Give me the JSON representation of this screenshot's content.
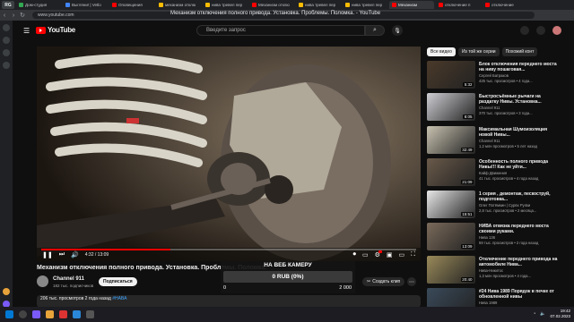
{
  "browser": {
    "tabs": [
      {
        "label": "Дом-студия",
        "color": "#34a853"
      },
      {
        "label": "Выгляни! | Vetlo",
        "color": "#4285f4"
      },
      {
        "label": "Оповещения",
        "color": "#ff0000"
      },
      {
        "label": "механизм отклю",
        "color": "#fbbc04"
      },
      {
        "label": "нива тревел пер",
        "color": "#fbbc04"
      },
      {
        "label": "Механизм отклю",
        "color": "#ff0000"
      },
      {
        "label": "нива тревел пер",
        "color": "#fbbc04"
      },
      {
        "label": "нива тревел пер",
        "color": "#fbbc04"
      },
      {
        "label": "Механизм",
        "color": "#ff0000",
        "active": true
      },
      {
        "label": "отключение п",
        "color": "#ff0000"
      },
      {
        "label": "отключение",
        "color": "#ff0000"
      }
    ],
    "logo": "RG",
    "url": "www.youtube.com",
    "page_title": "Механизм отключения полного привода. Установка. Проблемы. Поломка. - YouTube"
  },
  "youtube": {
    "brand": "YouTube",
    "search_placeholder": "Введите запрос"
  },
  "player": {
    "time": "4:32 / 13:09",
    "progress_fraction": 0.345
  },
  "video": {
    "title": "Механизм отключения полного привода. Установка. Проблемы. Поломка.",
    "channel": "Channel 911",
    "subscribers": "182 тыс. подписчиков",
    "subscribe_label": "Подписаться",
    "clip_label": "Создать клип",
    "stats": "206 тыс. просмотров 2 года назад",
    "stats_tag": "#НАВА"
  },
  "donation": {
    "title": "НА ВЕБ КАМЕРУ",
    "amount": "0 RUB (0%)",
    "min": "0",
    "max": "2 000"
  },
  "sidebar": {
    "chips": [
      "Все видео",
      "Из той же серии",
      "Похожий конт"
    ],
    "recommendations": [
      {
        "title": "Блок отключения переднего моста на ниву пошаговая...",
        "channel": "Сергей Батраков",
        "meta": "425 тыс. просмотров • 4 года...",
        "duration": "5:32",
        "color": "#4a3a2a"
      },
      {
        "title": "Быстросъёмные рычаги на раздатку Нивы. Установка...",
        "channel": "Channel 911",
        "meta": "370 тыс. просмотров • 3 года...",
        "duration": "8:05",
        "color": "#cfcfd4"
      },
      {
        "title": "Максимальная Шумоизоляция новой Нивы...",
        "channel": "Channel 911",
        "meta": "1,2 млн просмотров • 5 лет назад",
        "duration": "32:49",
        "color": "#c8c2b0"
      },
      {
        "title": "Особенность полного привода Нивы!!! Как не уйти...",
        "channel": "Кайф Движения",
        "meta": "41 тыс. просмотров • 4 года назад",
        "duration": "21:09",
        "color": "#6a5a4a"
      },
      {
        "title": "1 серия , демонтаж, пескоструй, подготовка...",
        "channel": "Олег Потёмкин | Сурвх Ру4ки",
        "meta": "2,8 тыс. просмотров • 2 месяца...",
        "duration": "15:51",
        "color": "#e8e8e8"
      },
      {
        "title": "НИВА отвязка переднего моста своими руками.",
        "channel": "Нива 136",
        "meta": "59 тыс. просмотров • 2 года назад",
        "duration": "13:09",
        "color": "#7a6a5a"
      },
      {
        "title": "Отключение переднего привода на автомобиле Нива...",
        "channel": "Нива-Никитос",
        "meta": "1,3 млн просмотров • 4 года...",
        "duration": "20:40",
        "color": "#9a8a5a"
      },
      {
        "title": "#24 Нива 1989 Порядок в печке от обновленной нивы",
        "channel": "Нива 1989",
        "meta": "50 тыс. просмотров • 2 года...",
        "duration": "20:09",
        "color": "#3a4a5a"
      }
    ]
  },
  "taskbar": {
    "time": "19:42",
    "date": "07.02.2023"
  }
}
